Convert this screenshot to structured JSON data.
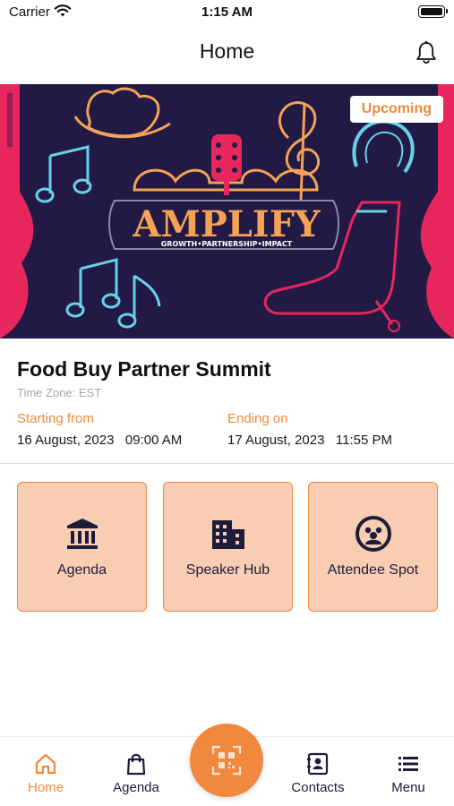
{
  "status_bar": {
    "carrier": "Carrier",
    "time": "1:15 AM"
  },
  "header": {
    "title": "Home"
  },
  "banner": {
    "badge": "Upcoming",
    "logo_title": "AMPLIFY",
    "logo_tagline": "GROWTH•PARTNERSHIP•IMPACT"
  },
  "event": {
    "title": "Food Buy Partner Summit",
    "timezone": "Time Zone: EST",
    "start_label": "Starting from",
    "start_value": "16 August, 2023   09:00 AM",
    "end_label": "Ending on",
    "end_value": "17 August, 2023   11:55 PM"
  },
  "tiles": [
    {
      "label": "Agenda",
      "icon": "institution-icon"
    },
    {
      "label": "Speaker Hub",
      "icon": "building-icon"
    },
    {
      "label": "Attendee Spot",
      "icon": "attendee-face-icon"
    }
  ],
  "tab_bar": {
    "items": [
      {
        "label": "Home",
        "icon": "home-icon",
        "active": true
      },
      {
        "label": "Agenda",
        "icon": "shopping-bag-icon",
        "active": false
      },
      {
        "label": "Contacts",
        "icon": "contact-card-icon",
        "active": false
      },
      {
        "label": "Menu",
        "icon": "list-menu-icon",
        "active": false
      }
    ],
    "center_button_icon": "qr-scan-icon"
  },
  "colors": {
    "accent": "#f0883e",
    "tile_fill": "#f8cdb4",
    "navy": "#1d1d3b",
    "banner_bg": "#221a44",
    "neon_pink": "#e8265e",
    "neon_blue": "#66d2ea"
  }
}
